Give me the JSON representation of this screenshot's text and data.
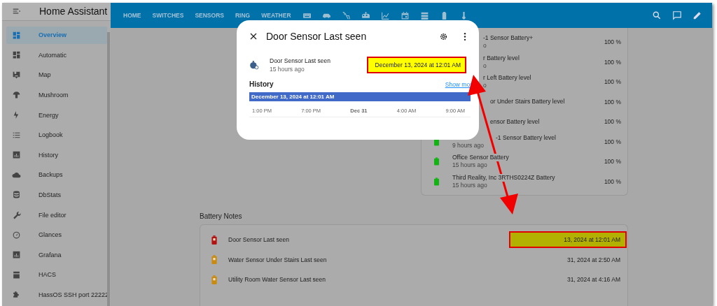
{
  "sidebar": {
    "title": "Home Assistant",
    "items": [
      {
        "label": "Overview",
        "selected": true
      },
      {
        "label": "Automatic",
        "selected": false
      },
      {
        "label": "Map",
        "selected": false
      },
      {
        "label": "Mushroom",
        "selected": false
      },
      {
        "label": "Energy",
        "selected": false
      },
      {
        "label": "Logbook",
        "selected": false
      },
      {
        "label": "History",
        "selected": false
      },
      {
        "label": "Backups",
        "selected": false
      },
      {
        "label": "DbStats",
        "selected": false
      },
      {
        "label": "File editor",
        "selected": false
      },
      {
        "label": "Glances",
        "selected": false
      },
      {
        "label": "Grafana",
        "selected": false
      },
      {
        "label": "HACS",
        "selected": false
      },
      {
        "label": "HassOS SSH port 22222",
        "selected": false
      }
    ]
  },
  "toolbar": {
    "tabs": [
      "HOME",
      "SWITCHES",
      "SENSORS",
      "RING",
      "WEATHER"
    ]
  },
  "battery_card": {
    "rows": [
      {
        "name": "-1 Sensor Battery+",
        "time": "o",
        "value": "100 %"
      },
      {
        "name": "r Battery level",
        "time": "o",
        "value": "100 %"
      },
      {
        "name": "r Left Battery level",
        "time": "o",
        "value": "100 %"
      },
      {
        "name": "or Under Stairs Battery level",
        "value": "100 %"
      },
      {
        "name": "ensor Battery level",
        "value": "100 %"
      },
      {
        "name": "-1 Sensor Battery level",
        "time": "9 hours ago",
        "value": "100 %",
        "color": "#12b312"
      },
      {
        "name": "Office Sensor Battery",
        "time": "15 hours ago",
        "value": "100 %",
        "color": "#12b312"
      },
      {
        "name": "Third Reality, Inc 3RTHS0224Z Battery",
        "time": "15 hours ago",
        "value": "100 %",
        "color": "#12b312"
      }
    ]
  },
  "battery_notes": {
    "title": "Battery Notes",
    "rows": [
      {
        "name": "Door Sensor Last seen",
        "value": "13, 2024 at 12:01 AM",
        "highlighted": true,
        "color": "#b31212"
      },
      {
        "name": "Water Sensor Under Stairs Last seen",
        "value": "31, 2024 at 2:50 AM",
        "highlighted": false,
        "color": "#c98a10"
      },
      {
        "name": "Utility Room Water Sensor Last seen",
        "value": "31, 2024 at 4:16 AM",
        "highlighted": false,
        "color": "#c98a10"
      }
    ]
  },
  "dialog": {
    "title": "Door Sensor Last seen",
    "entity": {
      "name": "Door Sensor Last seen",
      "time": "15 hours ago",
      "state": "December 13, 2024 at 12:01 AM",
      "highlighted": true
    },
    "history": {
      "title": "History",
      "link": "Show mor",
      "bar_label": "December 13, 2024 at 12:01 AM",
      "ticks": [
        {
          "label": "1:00 PM",
          "bold": false
        },
        {
          "label": "7:00 PM",
          "bold": false
        },
        {
          "label": "Dec 31",
          "bold": true
        },
        {
          "label": "4:00 AM",
          "bold": false
        },
        {
          "label": "9:00 AM",
          "bold": false
        }
      ]
    }
  }
}
